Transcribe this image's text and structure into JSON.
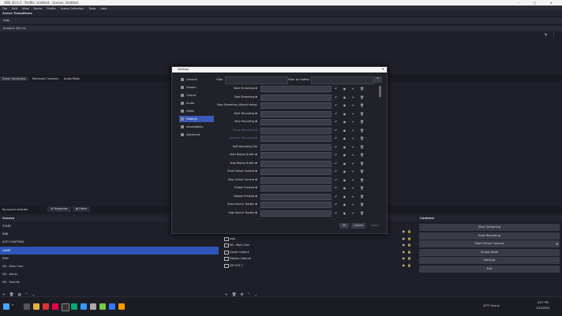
{
  "window": {
    "title": "OBS 30.0.2 - Profile: Untitled - Scenes: Untitled",
    "controls": "– ▢ ✕"
  },
  "menu": [
    "File",
    "Edit",
    "View",
    "Docks",
    "Profile",
    "Scene Collection",
    "Tools",
    "Help"
  ],
  "scene_transitions": {
    "header": "Scene Transitions",
    "transition": "Fade",
    "duration_label": "Duration",
    "duration_value": "300 ms"
  },
  "dock_tabs": [
    "Scene Transitions",
    "Reminder Channels",
    "Audio Mixer"
  ],
  "preview": {
    "no_source": "No source selected",
    "properties": "Properties",
    "filters": "Filters"
  },
  "scenes": {
    "header": "Scenes",
    "items": [
      "START",
      "BRB",
      "JUST CHATTING",
      "GAME",
      "END",
      "NS - Main Cam",
      "NS - Alerts",
      "NS - Sounds"
    ],
    "selected_index": 3
  },
  "sources": {
    "items": [
      "Webcam",
      "logo",
      "NS - Main Cam",
      "Game Capture",
      "Display Capture",
      "VM OUT 2"
    ]
  },
  "controls": {
    "header": "Controls",
    "items": [
      "Start Streaming",
      "Start Recording",
      "Start Virtual Camera",
      "Studio Mode",
      "Settings",
      "Exit"
    ]
  },
  "status": {
    "text": "0:00:00:00  REC 00:00:00",
    "cpu": "CPU: 3.0%, 60.00 / 60 fps"
  },
  "taskbar": {
    "search": "Search",
    "weather": "29°F Sunny",
    "time": "4:47 PM",
    "date": "1/20/2024"
  },
  "settings": {
    "title": "Settings",
    "categories": [
      "General",
      "Stream",
      "Output",
      "Audio",
      "Video",
      "Hotkeys",
      "Accessibility",
      "Advanced"
    ],
    "selected_category": 5,
    "filter_label": "Filter",
    "filter_hotkey_label": "Filter by Hotkey",
    "hotkeys": [
      {
        "label": "Start Streaming ✱",
        "disabled": false
      },
      {
        "label": "Stop Streaming ✱",
        "disabled": false
      },
      {
        "label": "Stop Streaming (discard delay)",
        "disabled": false
      },
      {
        "label": "Start Recording ✱",
        "disabled": false
      },
      {
        "label": "Stop Recording ✱",
        "disabled": false
      },
      {
        "label": "Pause Recording ✱",
        "disabled": true
      },
      {
        "label": "Unpause Recording ✱",
        "disabled": true
      },
      {
        "label": "Split Recording File",
        "disabled": false
      },
      {
        "label": "Start Replay Buffer ✱",
        "disabled": false
      },
      {
        "label": "Stop Replay Buffer ✱",
        "disabled": false
      },
      {
        "label": "Start Virtual Camera ✱",
        "disabled": false
      },
      {
        "label": "Stop Virtual Camera ✱",
        "disabled": false
      },
      {
        "label": "Enable Preview ✱",
        "disabled": false
      },
      {
        "label": "Disable Preview ✱",
        "disabled": false
      },
      {
        "label": "Show Source Toolbar ✱",
        "disabled": false
      },
      {
        "label": "Hide Source Toolbar ✱",
        "disabled": false
      }
    ],
    "row_icons": "↶ ◉ + 🗑",
    "ok": "OK",
    "cancel": "Cancel",
    "apply": "Apply"
  },
  "colors": {
    "accent": "#3a59b8",
    "selected_scene": "#2e56b8",
    "bg": "#1e1f29",
    "panel": "#23242f"
  }
}
